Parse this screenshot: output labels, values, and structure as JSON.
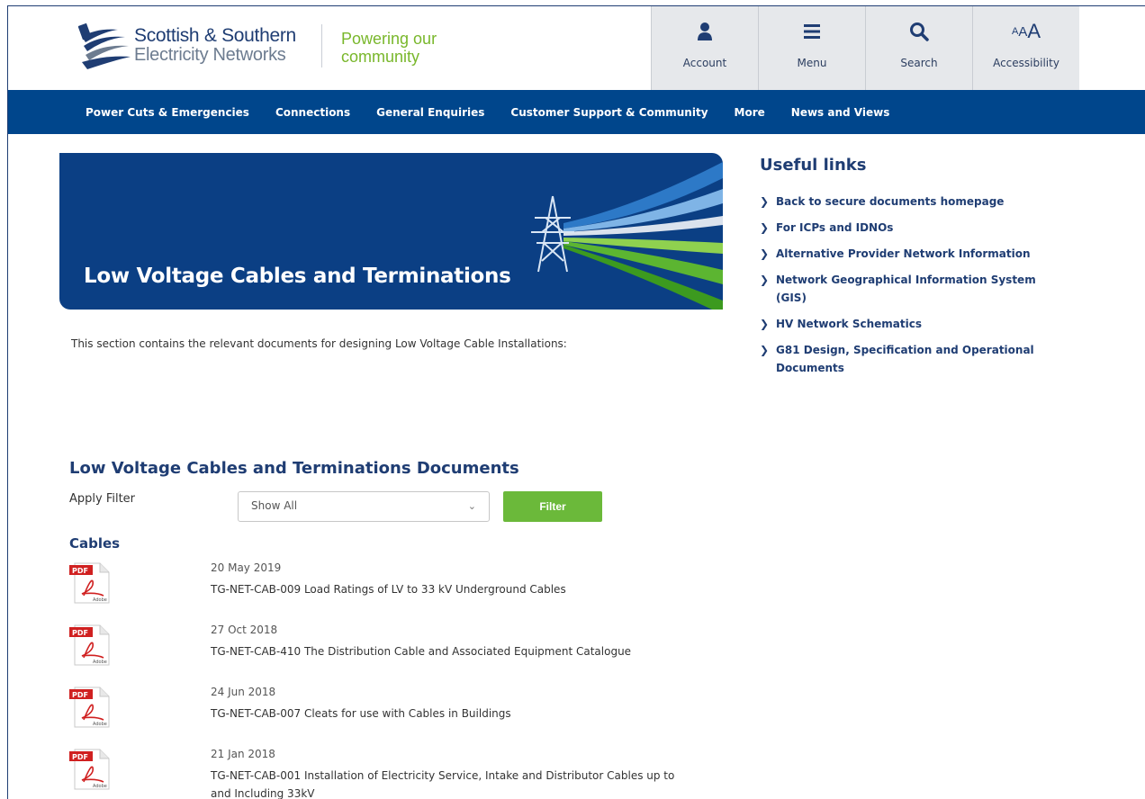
{
  "header": {
    "brand_line1": "Scottish & Southern",
    "brand_line2": "Electricity Networks",
    "tagline_line1": "Powering our",
    "tagline_line2": "community",
    "tools": [
      {
        "label": "Account",
        "icon": "user-icon"
      },
      {
        "label": "Menu",
        "icon": "menu-icon"
      },
      {
        "label": "Search",
        "icon": "search-icon"
      },
      {
        "label": "Accessibility",
        "icon": "text-size-icon",
        "glyph_small": "A",
        "glyph_mid": "A",
        "glyph_large": "A"
      }
    ]
  },
  "nav": {
    "items": [
      "Power Cuts & Emergencies",
      "Connections",
      "General Enquiries",
      "Customer Support & Community",
      "More",
      "News and Views"
    ]
  },
  "banner": {
    "title": "Low Voltage Cables and Terminations"
  },
  "intro": "This section contains the relevant documents for designing Low Voltage Cable Installations:",
  "useful_links": {
    "heading": "Useful links",
    "items": [
      "Back to secure documents homepage",
      "For ICPs and IDNOs",
      "Alternative Provider Network Information",
      "Network Geographical Information System (GIS)",
      "HV Network Schematics",
      "G81 Design, Specification and Operational Documents"
    ]
  },
  "documents": {
    "heading": "Low Voltage Cables and Terminations Documents",
    "filter_label": "Apply Filter",
    "filter_value": "Show All",
    "filter_button": "Filter",
    "section": "Cables",
    "pdf_badge": "PDF",
    "pdf_brand": "Adobe",
    "items": [
      {
        "date": "20 May 2019",
        "title": "TG-NET-CAB-009 Load Ratings of LV to 33 kV Underground Cables"
      },
      {
        "date": "27 Oct 2018",
        "title": "TG-NET-CAB-410 The Distribution Cable and Associated Equipment Catalogue"
      },
      {
        "date": "24 Jun 2018",
        "title": "TG-NET-CAB-007 Cleats for use with Cables in Buildings"
      },
      {
        "date": "21 Jan 2018",
        "title": "TG-NET-CAB-001 Installation of Electricity Service, Intake and Distributor Cables up to and Including 33kV"
      }
    ]
  },
  "colors": {
    "navy": "#00468c",
    "brand_blue": "#1f3d73",
    "green": "#6bb93a",
    "tool_bg": "#e6e8eb"
  }
}
